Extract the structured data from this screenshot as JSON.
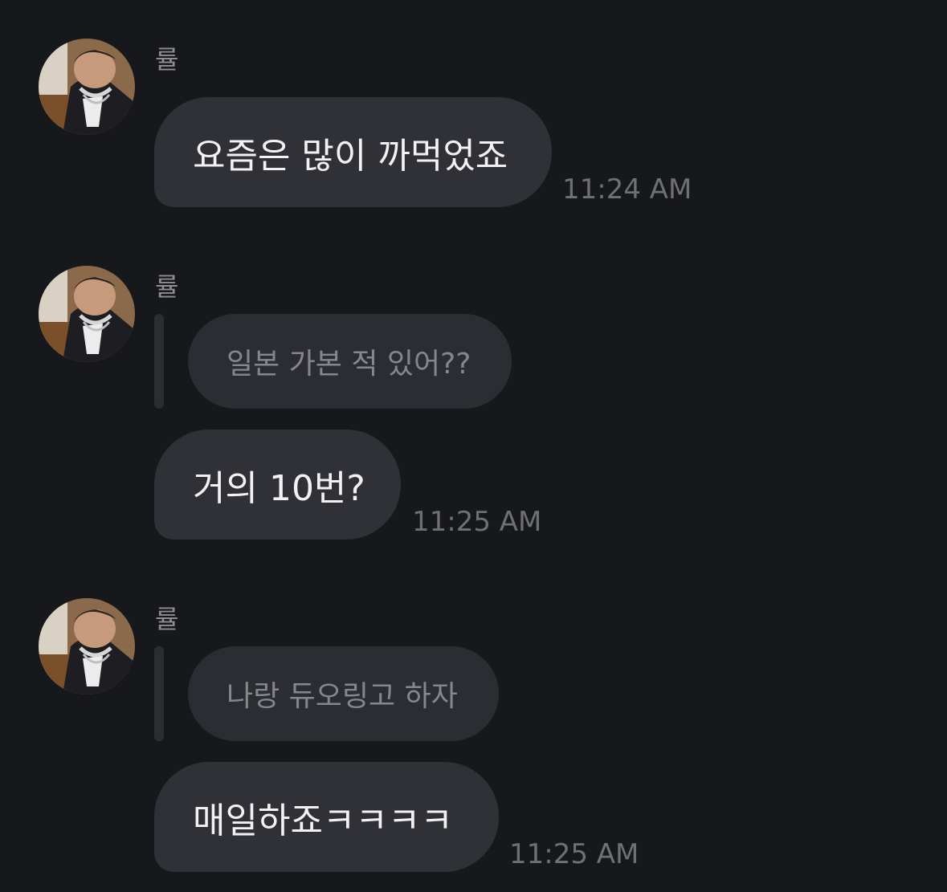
{
  "messages": [
    {
      "sender": "률",
      "avatar_icon": "user-avatar-icon",
      "text": "요즘은 많이 까먹었죠",
      "time": "11:24 AM"
    },
    {
      "sender": "률",
      "avatar_icon": "user-avatar-icon",
      "reply_to": "일본 가본 적 있어??",
      "text": "거의 10번?",
      "time": "11:25 AM"
    },
    {
      "sender": "률",
      "avatar_icon": "user-avatar-icon",
      "reply_to": "나랑 듀오링고 하자",
      "text": "매일하죠ㅋㅋㅋㅋ",
      "time": "11:25 AM"
    }
  ],
  "colors": {
    "background": "#17181c",
    "bubble": "#303136",
    "reply_bubble": "#2c2d32",
    "message_text": "#f2f2f4",
    "reply_text": "#86878c",
    "meta_text": "#8e8e93"
  }
}
